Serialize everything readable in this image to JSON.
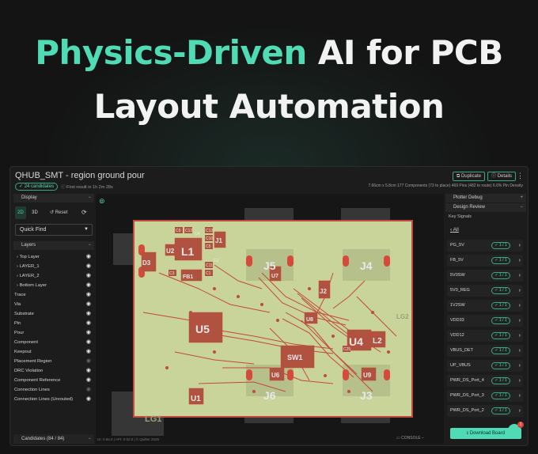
{
  "headline": {
    "accent": "Physics-Driven",
    "rest1": " AI for PCB",
    "line2": "Layout Automation"
  },
  "app": {
    "title": "QHUB_SMT - region ground pour",
    "candidates_badge": "24 candidates",
    "first_result": "First result in 1h  2m  28s",
    "duplicate_label": "Duplicate",
    "details_label": "Details",
    "stats": "7.66cm x 5.8cm   177 Components   (73 to place)   469 Pins   (482 to route)   6.6% Pin Density"
  },
  "left_panel": {
    "display_label": "Display",
    "mode_2d": "2D",
    "mode_3d": "3D",
    "reset_label": "Reset",
    "quick_find_label": "Quick Find",
    "layers_label": "Layers",
    "layers": [
      {
        "label": "Top Layer",
        "prefix": "›",
        "eye_dim": false
      },
      {
        "label": "LAYER_1",
        "prefix": "›",
        "eye_dim": false
      },
      {
        "label": "LAYER_2",
        "prefix": "›",
        "eye_dim": false
      },
      {
        "label": "Bottom Layer",
        "prefix": "›",
        "eye_dim": false
      },
      {
        "label": "Trace",
        "prefix": "",
        "eye_dim": false
      },
      {
        "label": "Via",
        "prefix": "",
        "eye_dim": false
      },
      {
        "label": "Substrate",
        "prefix": "",
        "eye_dim": false
      },
      {
        "label": "Pin",
        "prefix": "",
        "eye_dim": false
      },
      {
        "label": "Pour",
        "prefix": "",
        "eye_dim": false
      },
      {
        "label": "Component",
        "prefix": "",
        "eye_dim": false
      },
      {
        "label": "Keepout",
        "prefix": "",
        "eye_dim": false
      },
      {
        "label": "Placement Region",
        "prefix": "",
        "eye_dim": true
      },
      {
        "label": "DRC Violation",
        "prefix": "",
        "eye_dim": false
      },
      {
        "label": "Component Reference",
        "prefix": "",
        "eye_dim": false
      },
      {
        "label": "Connection Lines",
        "prefix": "",
        "eye_dim": true
      },
      {
        "label": "Connection Lines (Unrouted)",
        "prefix": "",
        "eye_dim": false
      }
    ],
    "candidates_bar": "Candidates (84 / 84)"
  },
  "canvas": {
    "footer_version": "UI: 0.84.0 | API: 0.52.0 | © Quilter 2025",
    "console_label": "CONSOLE",
    "refs": {
      "L1": "L1",
      "U2": "U2",
      "J1": "J1",
      "D3": "D3",
      "FB1": "FB1",
      "J5": "J5",
      "J4": "J4",
      "U7": "U7",
      "J2": "J2",
      "U5": "U5",
      "U8": "U8",
      "U4": "U4",
      "L2": "L2",
      "SW1": "SW1",
      "U6": "U6",
      "U9": "U9",
      "U1": "U1",
      "J6": "J6",
      "J3": "J3",
      "LG1": "LG1",
      "LG2": "LG2",
      "C9": "C9",
      "C12": "C12",
      "C3": "C3",
      "C11": "C11",
      "C5": "C5",
      "C10": "C10",
      "C1": "C1",
      "C2": "C2",
      "C13": "C13",
      "C4": "C4",
      "C25": "C25"
    },
    "colors": {
      "board": "#c8d49a",
      "copper": "#c24a3e",
      "pad": "#d64a3c",
      "shadow": "#3a3a3a"
    }
  },
  "right_panel": {
    "plotter_debug": "Plotter Debug",
    "design_review": "Design Review",
    "key_signals": "Key Signals",
    "all_link": "All",
    "signals": [
      {
        "name": "PG_5V",
        "pill": "1 / 1"
      },
      {
        "name": "FB_5V",
        "pill": "1 / 1"
      },
      {
        "name": "5V0SW",
        "pill": "1 / 1"
      },
      {
        "name": "5V0_REG",
        "pill": "1 / 1"
      },
      {
        "name": "1V2SW",
        "pill": "1 / 1"
      },
      {
        "name": "VDD33",
        "pill": "1 / 1"
      },
      {
        "name": "VDD12",
        "pill": "1 / 1"
      },
      {
        "name": "VBUS_DET",
        "pill": "1 / 1"
      },
      {
        "name": "UP_VBUS",
        "pill": "1 / 1"
      },
      {
        "name": "PWR_DS_Port_4",
        "pill": "1 / 1"
      },
      {
        "name": "PWR_DS_Port_3",
        "pill": "1 / 1"
      },
      {
        "name": "PWR_DS_Port_2",
        "pill": "1 / 1"
      }
    ],
    "download_label": "Download Board"
  },
  "chat": {
    "badge": "1"
  }
}
